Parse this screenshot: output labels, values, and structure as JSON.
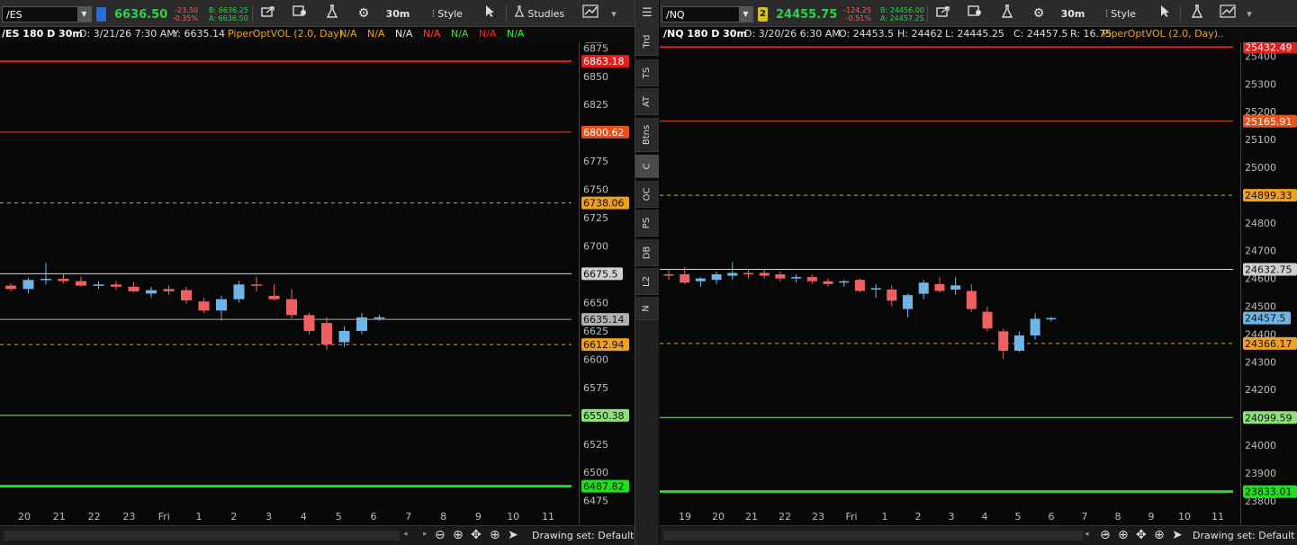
{
  "colors": {
    "bull": "#6fb6e8",
    "bear": "#f06060",
    "red_line": "#e02020",
    "orange_line": "#e8501c",
    "orange_dash": "#f0a020",
    "white_line": "#d8d8d8",
    "gray_line": "#a8a8a8",
    "lime_line": "#8ee07a",
    "green_line": "#22dd22",
    "study_text": "#f0a020"
  },
  "toolbar_common": {
    "interval": "30m",
    "style_label": "Style",
    "studies_label": "Studies"
  },
  "left": {
    "symbol": "/ES",
    "link_number": "",
    "last_price": "6636.50",
    "change": "-23.50",
    "change_pct": "-0.35%",
    "bid": "B: 6636.25",
    "ask": "A: 6636.50",
    "chart_title": "/ES 180 D 30m",
    "date_label": "D: 3/21/26 7:30 AM",
    "y_label": "Y: 6635.14",
    "study_label": "PiperOptVOL (2.0, Day)",
    "study_values": [
      {
        "text": "N/A",
        "color": "#f0a020"
      },
      {
        "text": "N/A",
        "color": "#f0a020"
      },
      {
        "text": "N/A",
        "color": "#e8e8e8"
      },
      {
        "text": "N/A",
        "color": "#ff4040"
      },
      {
        "text": "N/A",
        "color": "#40e040"
      },
      {
        "text": "N/A",
        "color": "#ff2020"
      },
      {
        "text": "N/A",
        "color": "#20ff20"
      }
    ],
    "price_axis": [
      "6875",
      "6850",
      "6825",
      "6800",
      "6775",
      "6750",
      "6725",
      "6700",
      "6675",
      "6650",
      "6625",
      "6600",
      "6575",
      "6550",
      "6525",
      "6500",
      "6475"
    ],
    "badges": [
      {
        "text": "6863.18",
        "kind": "red_line"
      },
      {
        "text": "6800.62",
        "kind": "orange_line"
      },
      {
        "text": "6738.06",
        "kind": "orange_dash"
      },
      {
        "text": "6675.5",
        "kind": "white_line"
      },
      {
        "text": "6635.14",
        "kind": "gray_line"
      },
      {
        "text": "6612.94",
        "kind": "orange_dash"
      },
      {
        "text": "6550.38",
        "kind": "lime_line"
      },
      {
        "text": "6487.82",
        "kind": "green_line"
      }
    ],
    "time_axis": [
      "20",
      "21",
      "22",
      "23",
      "Fri",
      "1",
      "2",
      "3",
      "4",
      "5",
      "6",
      "7",
      "8",
      "9",
      "10",
      "11"
    ],
    "drawing_set": "Drawing set: Default"
  },
  "right": {
    "symbol": "/NQ",
    "link_number": "2",
    "last_price": "24455.75",
    "change": "-124.25",
    "change_pct": "-0.51%",
    "bid": "B: 24456.00",
    "ask": "A: 24457.25",
    "chart_title": "/NQ 180 D 30m",
    "date_label": "D: 3/20/26 6:30 AM",
    "o_label": "O: 24453.5",
    "h_label": "H: 24462",
    "l_label": "L: 24445.25",
    "c_label": "C: 24457.5",
    "r_label": "R: 16.75",
    "study_label": "PiperOptVOL (2.0, Day)",
    "price_axis": [
      "25400",
      "25300",
      "25200",
      "25100",
      "25000",
      "24900",
      "24800",
      "24700",
      "24600",
      "24500",
      "24400",
      "24300",
      "24200",
      "24100",
      "24000",
      "23900",
      "23800"
    ],
    "badges": [
      {
        "text": "25432.49",
        "kind": "red_line"
      },
      {
        "text": "25165.91",
        "kind": "orange_line"
      },
      {
        "text": "24899.33",
        "kind": "orange_dash"
      },
      {
        "text": "24632.75",
        "kind": "white_line"
      },
      {
        "text": "24457.5",
        "kind": "bull"
      },
      {
        "text": "24366.17",
        "kind": "orange_dash"
      },
      {
        "text": "24099.59",
        "kind": "lime_line"
      },
      {
        "text": "23833.01",
        "kind": "green_line"
      }
    ],
    "time_axis": [
      "19",
      "20",
      "21",
      "22",
      "23",
      "Fri",
      "1",
      "2",
      "3",
      "4",
      "5",
      "6",
      "7",
      "8",
      "9",
      "10",
      "11"
    ],
    "drawing_set": "Drawing set: Default"
  },
  "side_tabs": [
    "Trd",
    "TS",
    "AT",
    "Btns",
    "C",
    "OC",
    "PS",
    "DB",
    "L2",
    "N"
  ],
  "chart_data": [
    {
      "type": "candlestick",
      "title": "/ES 180 D 30m",
      "ylim": [
        6470,
        6880
      ],
      "x_ticks": [
        "20",
        "21",
        "22",
        "23",
        "Fri",
        "1",
        "2",
        "3",
        "4",
        "5",
        "6",
        "7",
        "8",
        "9",
        "10",
        "11"
      ],
      "levels": [
        6863.18,
        6800.62,
        6738.06,
        6675.5,
        6635.14,
        6612.94,
        6550.38,
        6487.82
      ],
      "candles": [
        {
          "o": 6665,
          "h": 6667,
          "l": 6660,
          "c": 6662
        },
        {
          "o": 6662,
          "h": 6672,
          "l": 6658,
          "c": 6670
        },
        {
          "o": 6670,
          "h": 6685,
          "l": 6666,
          "c": 6671
        },
        {
          "o": 6671,
          "h": 6675,
          "l": 6667,
          "c": 6669
        },
        {
          "o": 6669,
          "h": 6673,
          "l": 6664,
          "c": 6665
        },
        {
          "o": 6665,
          "h": 6669,
          "l": 6662,
          "c": 6666
        },
        {
          "o": 6666,
          "h": 6669,
          "l": 6661,
          "c": 6664
        },
        {
          "o": 6664,
          "h": 6668,
          "l": 6659,
          "c": 6660
        },
        {
          "o": 6658,
          "h": 6664,
          "l": 6654,
          "c": 6661
        },
        {
          "o": 6662,
          "h": 6665,
          "l": 6657,
          "c": 6660
        },
        {
          "o": 6661,
          "h": 6664,
          "l": 6649,
          "c": 6652
        },
        {
          "o": 6651,
          "h": 6654,
          "l": 6641,
          "c": 6643
        },
        {
          "o": 6643,
          "h": 6656,
          "l": 6634,
          "c": 6653
        },
        {
          "o": 6653,
          "h": 6669,
          "l": 6650,
          "c": 6666
        },
        {
          "o": 6666,
          "h": 6673,
          "l": 6660,
          "c": 6665
        },
        {
          "o": 6656,
          "h": 6666,
          "l": 6652,
          "c": 6653
        },
        {
          "o": 6653,
          "h": 6662,
          "l": 6636,
          "c": 6639
        },
        {
          "o": 6639,
          "h": 6641,
          "l": 6622,
          "c": 6625
        },
        {
          "o": 6632,
          "h": 6637,
          "l": 6608,
          "c": 6613
        },
        {
          "o": 6615,
          "h": 6629,
          "l": 6611,
          "c": 6625
        },
        {
          "o": 6625,
          "h": 6641,
          "l": 6622,
          "c": 6637
        },
        {
          "o": 6636,
          "h": 6639,
          "l": 6634,
          "c": 6637
        }
      ]
    },
    {
      "type": "candlestick",
      "title": "/NQ 180 D 30m",
      "ylim": [
        23780,
        25450
      ],
      "x_ticks": [
        "19",
        "20",
        "21",
        "22",
        "23",
        "Fri",
        "1",
        "2",
        "3",
        "4",
        "5",
        "6",
        "7",
        "8",
        "9",
        "10",
        "11"
      ],
      "levels": [
        25432.49,
        25165.91,
        24899.33,
        24632.75,
        24457.5,
        24366.17,
        24099.59,
        23833.01
      ],
      "candles": [
        {
          "o": 24615,
          "h": 24630,
          "l": 24595,
          "c": 24610
        },
        {
          "o": 24615,
          "h": 24640,
          "l": 24580,
          "c": 24585
        },
        {
          "o": 24590,
          "h": 24605,
          "l": 24570,
          "c": 24600
        },
        {
          "o": 24595,
          "h": 24625,
          "l": 24580,
          "c": 24615
        },
        {
          "o": 24610,
          "h": 24660,
          "l": 24595,
          "c": 24620
        },
        {
          "o": 24620,
          "h": 24635,
          "l": 24600,
          "c": 24615
        },
        {
          "o": 24620,
          "h": 24635,
          "l": 24600,
          "c": 24610
        },
        {
          "o": 24615,
          "h": 24625,
          "l": 24590,
          "c": 24600
        },
        {
          "o": 24600,
          "h": 24615,
          "l": 24585,
          "c": 24605
        },
        {
          "o": 24605,
          "h": 24615,
          "l": 24580,
          "c": 24590
        },
        {
          "o": 24590,
          "h": 24600,
          "l": 24570,
          "c": 24580
        },
        {
          "o": 24585,
          "h": 24595,
          "l": 24570,
          "c": 24590
        },
        {
          "o": 24595,
          "h": 24600,
          "l": 24550,
          "c": 24555
        },
        {
          "o": 24560,
          "h": 24580,
          "l": 24530,
          "c": 24565
        },
        {
          "o": 24560,
          "h": 24575,
          "l": 24500,
          "c": 24520
        },
        {
          "o": 24490,
          "h": 24545,
          "l": 24460,
          "c": 24540
        },
        {
          "o": 24545,
          "h": 24595,
          "l": 24525,
          "c": 24585
        },
        {
          "o": 24580,
          "h": 24605,
          "l": 24550,
          "c": 24555
        },
        {
          "o": 24560,
          "h": 24605,
          "l": 24540,
          "c": 24575
        },
        {
          "o": 24555,
          "h": 24580,
          "l": 24480,
          "c": 24490
        },
        {
          "o": 24480,
          "h": 24500,
          "l": 24410,
          "c": 24420
        },
        {
          "o": 24410,
          "h": 24420,
          "l": 24310,
          "c": 24340
        },
        {
          "o": 24340,
          "h": 24410,
          "l": 24335,
          "c": 24395
        },
        {
          "o": 24395,
          "h": 24475,
          "l": 24380,
          "c": 24455
        },
        {
          "o": 24453.5,
          "h": 24462,
          "l": 24445.25,
          "c": 24457.5
        }
      ]
    }
  ]
}
